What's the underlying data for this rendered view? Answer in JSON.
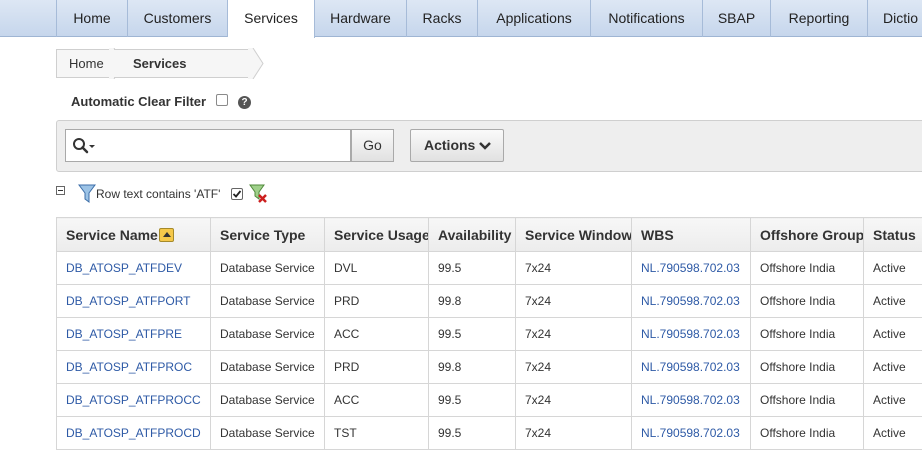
{
  "nav": {
    "tabs": [
      {
        "label": "Home"
      },
      {
        "label": "Customers"
      },
      {
        "label": "Services",
        "active": true
      },
      {
        "label": "Hardware"
      },
      {
        "label": "Racks"
      },
      {
        "label": "Applications"
      },
      {
        "label": "Notifications"
      },
      {
        "label": "SBAP"
      },
      {
        "label": "Reporting"
      },
      {
        "label": "Dictio"
      }
    ]
  },
  "breadcrumb": {
    "home": "Home",
    "current": "Services"
  },
  "clear_filter": {
    "label": "Automatic Clear Filter",
    "checked": false,
    "help_icon": "help-icon"
  },
  "toolbar": {
    "search_value": "",
    "go_label": "Go",
    "actions_label": "Actions"
  },
  "filter": {
    "text": "Row text contains 'ATF'",
    "enabled": true
  },
  "table": {
    "columns": [
      "Service Name",
      "Service Type",
      "Service Usage",
      "Availability",
      "Service Window",
      "WBS",
      "Offshore Group",
      "Status"
    ],
    "sorted_column": "Service Name",
    "sort_direction": "ascending",
    "rows": [
      [
        "DB_ATOSP_ATFDEV",
        "Database Service",
        "DVL",
        "99.5",
        "7x24",
        "NL.790598.702.03",
        "Offshore India",
        "Active"
      ],
      [
        "DB_ATOSP_ATFPORT",
        "Database Service",
        "PRD",
        "99.8",
        "7x24",
        "NL.790598.702.03",
        "Offshore India",
        "Active"
      ],
      [
        "DB_ATOSP_ATFPRE",
        "Database Service",
        "ACC",
        "99.5",
        "7x24",
        "NL.790598.702.03",
        "Offshore India",
        "Active"
      ],
      [
        "DB_ATOSP_ATFPROC",
        "Database Service",
        "PRD",
        "99.8",
        "7x24",
        "NL.790598.702.03",
        "Offshore India",
        "Active"
      ],
      [
        "DB_ATOSP_ATFPROCC",
        "Database Service",
        "ACC",
        "99.5",
        "7x24",
        "NL.790598.702.03",
        "Offshore India",
        "Active"
      ],
      [
        "DB_ATOSP_ATFPROCD",
        "Database Service",
        "TST",
        "99.5",
        "7x24",
        "NL.790598.702.03",
        "Offshore India",
        "Active"
      ]
    ]
  },
  "colors": {
    "nav_bg": "#c6d6ec",
    "link": "#2e5aa6",
    "sort_badge": "#f5c84a"
  }
}
